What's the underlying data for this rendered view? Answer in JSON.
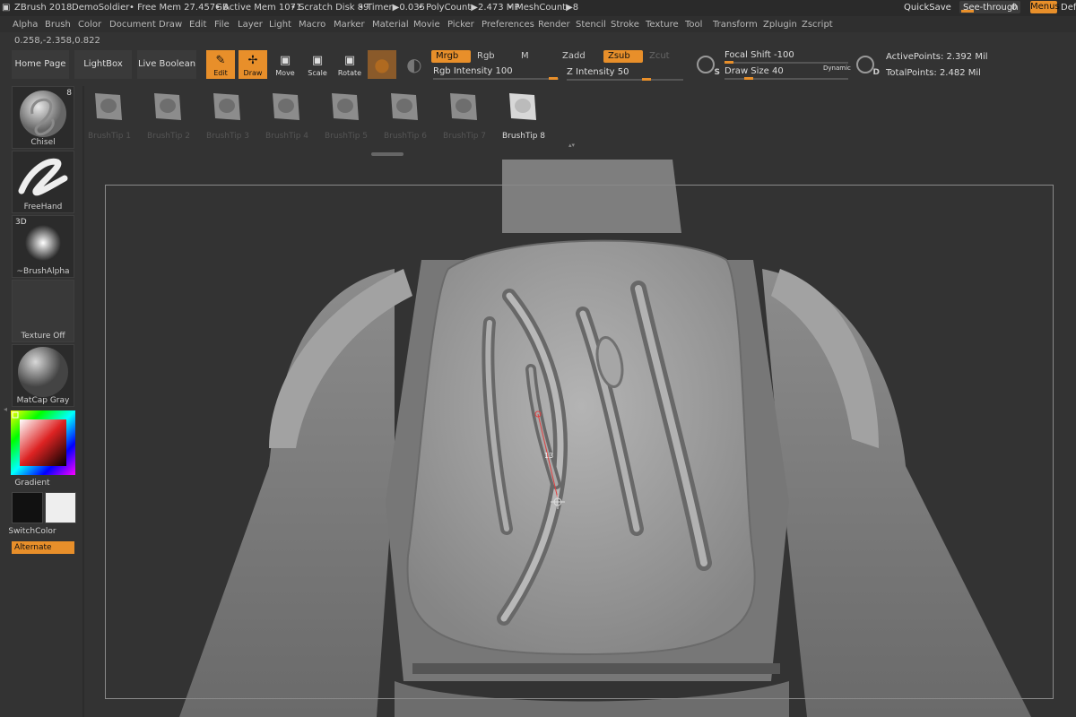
{
  "titlebar": {
    "app": "ZBrush 2018",
    "project": "DemoSoldier",
    "free_mem": "• Free Mem 27.457GB",
    "active_mem": "• Active Mem 1071",
    "scratch": "• Scratch Disk 89",
    "timer": "• Timer▶0.035",
    "polycount": "• PolyCount▶2.473 MP",
    "meshcount": "• MeshCount▶8",
    "quicksave": "QuickSave",
    "see_through": "See-through",
    "see_through_value": "0",
    "menus": "Menus",
    "def": "Def"
  },
  "menubar": [
    "Alpha",
    "Brush",
    "Color",
    "Document",
    "Draw",
    "Edit",
    "File",
    "Layer",
    "Light",
    "Macro",
    "Marker",
    "Material",
    "Movie",
    "Picker",
    "Preferences",
    "Render",
    "Stencil",
    "Stroke",
    "Texture",
    "Tool",
    "Transform",
    "Zplugin",
    "Zscript"
  ],
  "coords": "0.258,-2.358,0.822",
  "nav": {
    "home": "Home Page",
    "lightbox": "LightBox",
    "live_boolean": "Live Boolean"
  },
  "tools": {
    "edit": "Edit",
    "draw": "Draw",
    "move": "Move",
    "scale": "Scale",
    "rotate": "Rotate"
  },
  "color_modes": {
    "mrgb": "Mrgb",
    "rgb": "Rgb",
    "m": "M",
    "rgb_intensity": "Rgb Intensity 100"
  },
  "z_modes": {
    "zadd": "Zadd",
    "zsub": "Zsub",
    "zcut": "Zcut",
    "z_intensity": "Z Intensity 50"
  },
  "brush_settings": {
    "focal_shift": "Focal Shift -100",
    "draw_size": "Draw Size 40",
    "dynamic": "Dynamic",
    "s_label": "S",
    "d_label": "D"
  },
  "stats": {
    "active_points": "ActivePoints: 2.392 Mil",
    "total_points": "TotalPoints: 2.482 Mil"
  },
  "left_tray": {
    "brush": "Chisel",
    "brush_count": "8",
    "stroke": "FreeHand",
    "alpha_3d": "3D",
    "alpha": "~BrushAlpha",
    "texture": "Texture Off",
    "material": "MatCap Gray",
    "gradient": "Gradient",
    "switch_color": "SwitchColor",
    "alternate": "Alternate"
  },
  "brush_tips": [
    "BrushTip 1",
    "BrushTip 2",
    "BrushTip 3",
    "BrushTip 4",
    "BrushTip 5",
    "BrushTip 6",
    "BrushTip 7",
    "BrushTip 8"
  ],
  "stroke_measure": "13",
  "colors": {
    "accent": "#e88f2a",
    "panel": "#333333",
    "model": "#9a9a9a"
  }
}
